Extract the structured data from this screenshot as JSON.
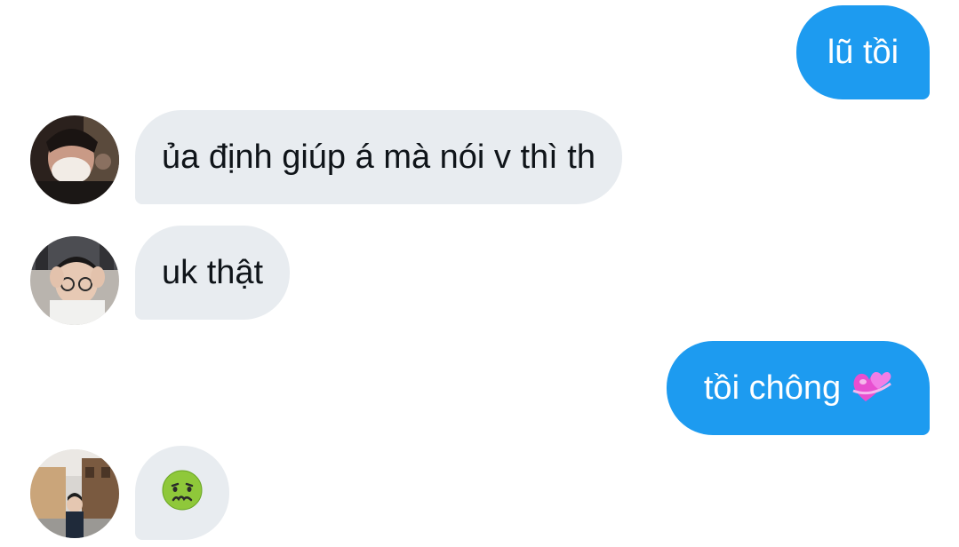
{
  "conversation": {
    "messages": [
      {
        "direction": "outgoing",
        "text": "lũ tồi"
      },
      {
        "direction": "incoming",
        "text": "ủa định giúp á mà nói v thì th",
        "avatar": "avatar-person-mask"
      },
      {
        "direction": "incoming",
        "text": "uk thật",
        "avatar": "avatar-person-glasses"
      },
      {
        "direction": "outgoing",
        "text": "tồi chông",
        "emoji": "two-hearts-emoji"
      },
      {
        "direction": "incoming",
        "text": "",
        "emoji": "nauseated-face-emoji",
        "avatar": "avatar-person-street"
      }
    ]
  },
  "colors": {
    "outgoing_bubble": "#1d9bf0",
    "incoming_bubble": "#e8ecf0",
    "incoming_text": "#0f1419",
    "outgoing_text": "#ffffff"
  }
}
